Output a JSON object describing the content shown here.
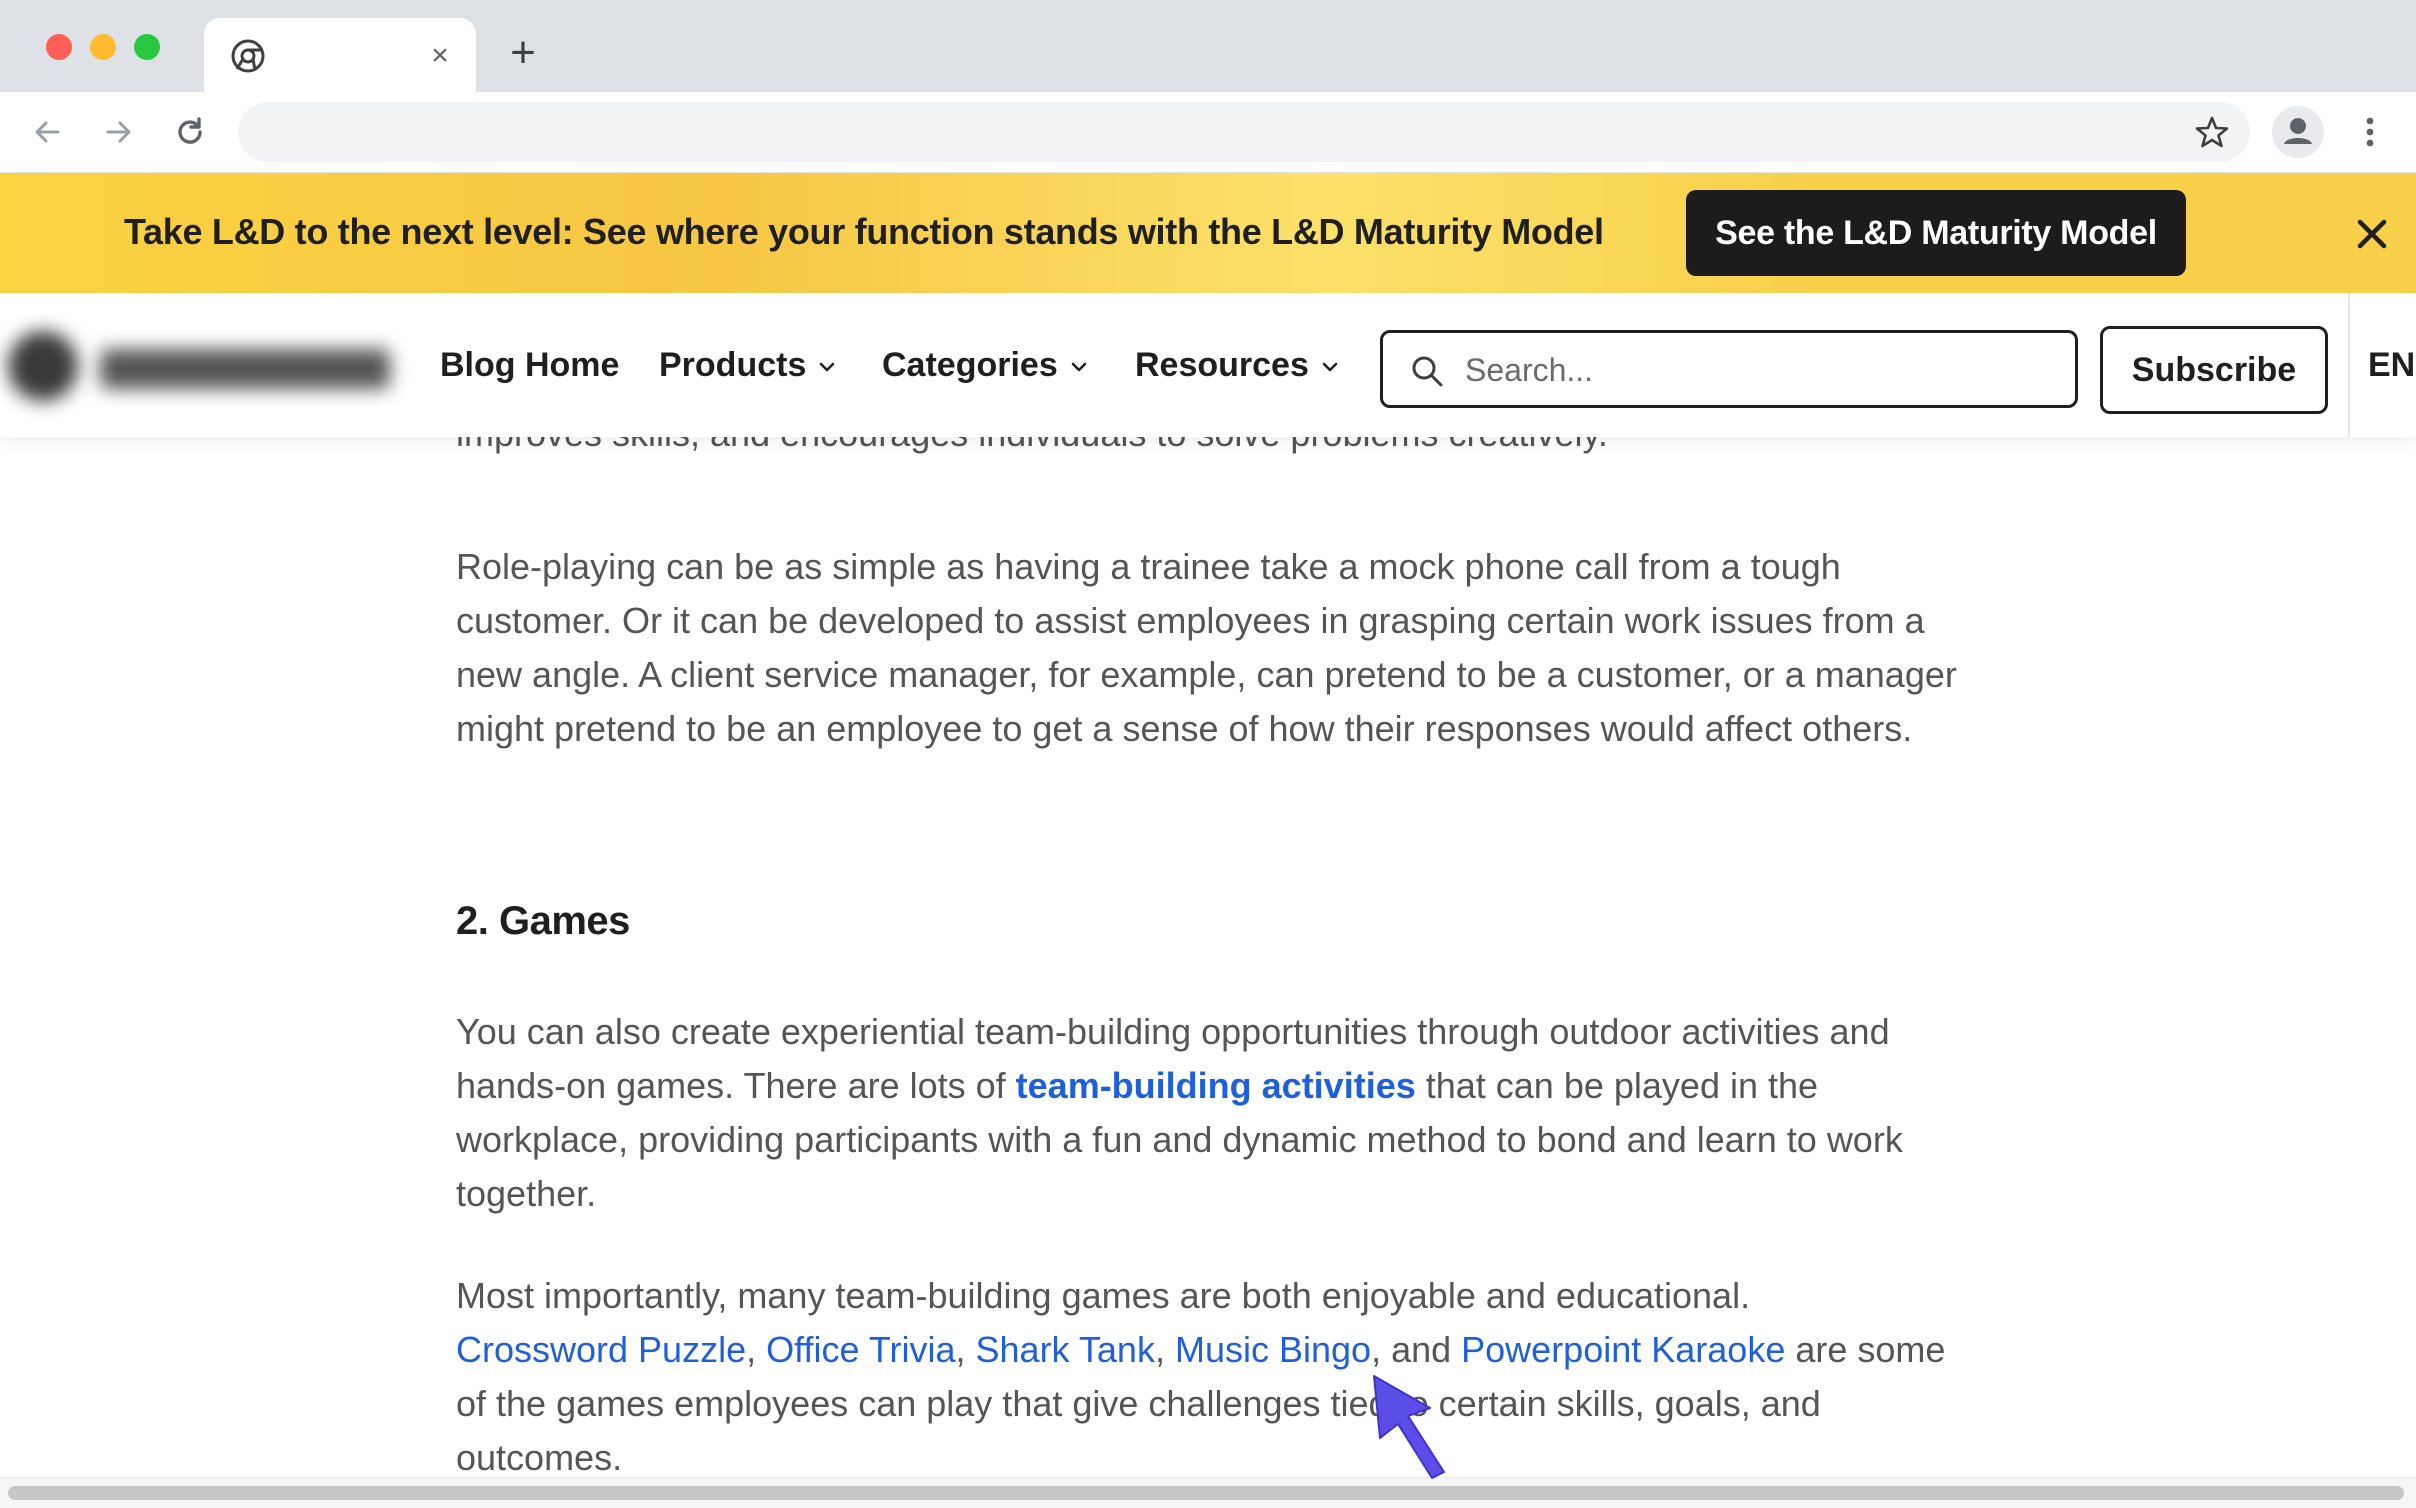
{
  "browser": {
    "tab_close_glyph": "×",
    "new_tab_glyph": "+",
    "icons": [
      "back-arrow-icon",
      "forward-arrow-icon",
      "reload-icon",
      "bookmark-star-icon",
      "profile-icon",
      "kebab-menu-icon",
      "chrome-favicon-icon"
    ]
  },
  "banner": {
    "text": "Take L&D to the next level: See where your function stands with the L&D Maturity Model",
    "cta": "See the L&D Maturity Model",
    "color": "#f8d04a"
  },
  "header": {
    "nav": [
      {
        "label": "Blog Home",
        "has_dropdown": false
      },
      {
        "label": "Products",
        "has_dropdown": true
      },
      {
        "label": "Categories",
        "has_dropdown": true
      },
      {
        "label": "Resources",
        "has_dropdown": true
      }
    ],
    "search_placeholder": "Search...",
    "subscribe": "Subscribe",
    "language": "EN"
  },
  "article": {
    "intro_tail": "improves skills, and encourages individuals to solve problems creatively.",
    "role_playing_paragraph": "Role-playing can be as simple as having a trainee take a mock phone call from a tough customer. Or it can be developed to assist employees in grasping certain work issues from a new angle. A client service manager, for example, can pretend to be a customer, or a manager might pretend to be an employee to get a sense of how their responses would affect others.",
    "section_heading": "2. Games",
    "games_paragraph": {
      "before": "You can also create experiential team-building opportunities through outdoor activities and hands-on games. There are lots of ",
      "link": "team-building activities",
      "after": " that can be played in the workplace, providing participants with a fun and dynamic method to bond and learn to work together."
    },
    "games_list_paragraph": {
      "lead": "Most importantly, many team-building games are both enjoyable and educational.",
      "links": [
        "Crossword Puzzle",
        "Office Trivia",
        "Shark Tank",
        "Music Bingo",
        "Powerpoint Karaoke"
      ],
      "sep": ", ",
      "and": ", and ",
      "tail": " are some of the games employees can play that give challenges tied to certain skills, goals, and outcomes."
    },
    "link_color": "#1f5fd9"
  }
}
